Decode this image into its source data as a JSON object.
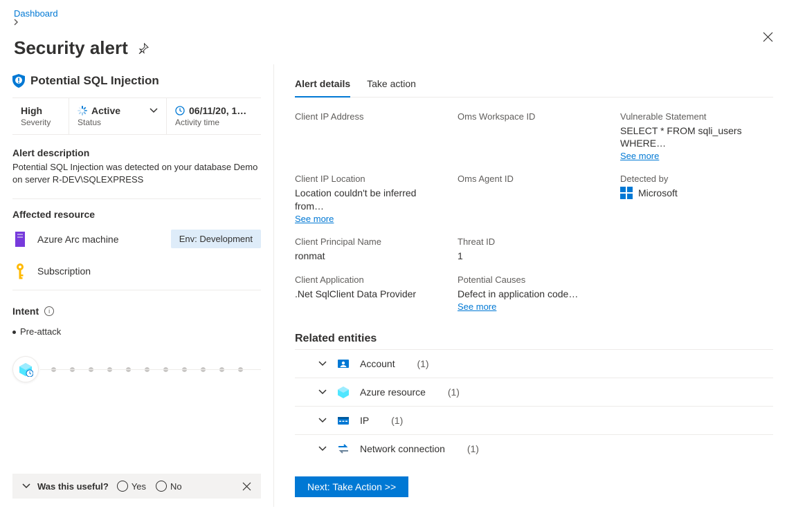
{
  "breadcrumb": {
    "dashboard": "Dashboard"
  },
  "page_title": "Security alert",
  "alert": {
    "name": "Potential SQL Injection",
    "severity": {
      "value": "High",
      "label": "Severity"
    },
    "status": {
      "value": "Active",
      "label": "Status"
    },
    "activity": {
      "value": "06/11/20, 1…",
      "label": "Activity time"
    }
  },
  "description": {
    "title": "Alert description",
    "text": "Potential SQL Injection was detected on your database Demo on server R-DEV\\SQLEXPRESS"
  },
  "affected": {
    "title": "Affected resource",
    "rows": [
      {
        "name": "Azure Arc machine",
        "tag": "Env: Development"
      },
      {
        "name": "Subscription"
      }
    ]
  },
  "intent": {
    "title": "Intent",
    "value": "Pre-attack"
  },
  "useful": {
    "question": "Was this useful?",
    "yes": "Yes",
    "no": "No"
  },
  "tabs": {
    "details": "Alert details",
    "action": "Take action"
  },
  "details": {
    "client_ip_address": {
      "label": "Client IP Address",
      "value": ""
    },
    "oms_workspace_id": {
      "label": "Oms Workspace ID",
      "value": ""
    },
    "vulnerable_statement": {
      "label": "Vulnerable Statement",
      "value": "SELECT * FROM sqli_users WHERE…",
      "see_more": "See more"
    },
    "client_ip_location": {
      "label": "Client IP Location",
      "value": "Location couldn't be inferred from…",
      "see_more": "See more"
    },
    "oms_agent_id": {
      "label": "Oms Agent ID",
      "value": ""
    },
    "detected_by": {
      "label": "Detected by",
      "value": "Microsoft"
    },
    "client_principal": {
      "label": "Client Principal Name",
      "value": "ronmat"
    },
    "threat_id": {
      "label": "Threat ID",
      "value": "1"
    },
    "client_application": {
      "label": "Client Application",
      "value": ".Net SqlClient Data Provider"
    },
    "potential_causes": {
      "label": "Potential Causes",
      "value": "Defect in application code…",
      "see_more": "See more"
    }
  },
  "related": {
    "title": "Related entities",
    "items": [
      {
        "name": "Account",
        "count": "(1)"
      },
      {
        "name": "Azure resource",
        "count": "(1)"
      },
      {
        "name": "IP",
        "count": "(1)"
      },
      {
        "name": "Network connection",
        "count": "(1)"
      }
    ]
  },
  "next_button": "Next: Take Action  >>"
}
